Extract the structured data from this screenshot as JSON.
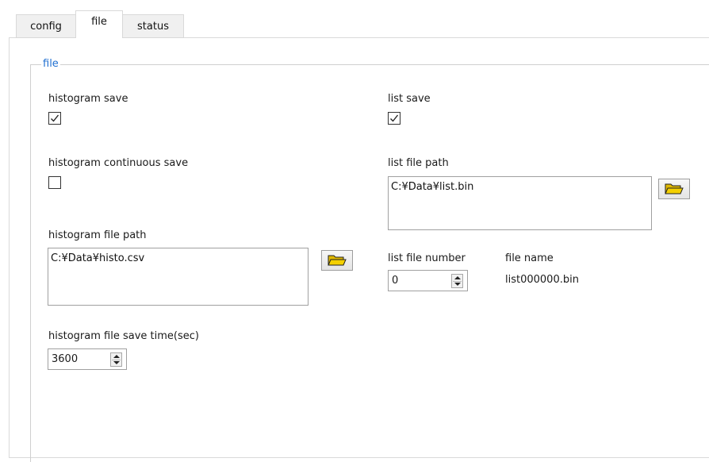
{
  "tabs": [
    {
      "label": "config"
    },
    {
      "label": "file",
      "active": true
    },
    {
      "label": "status"
    }
  ],
  "group": {
    "title": "file"
  },
  "histogram": {
    "save_label": "histogram save",
    "save_checked": true,
    "continuous_label": "histogram continuous save",
    "continuous_checked": false,
    "path_label": "histogram file path",
    "path_value": "C:¥Data¥histo.csv",
    "save_time_label": "histogram file save time(sec)",
    "save_time_value": "3600"
  },
  "list": {
    "save_label": "list save",
    "save_checked": true,
    "path_label": "list file path",
    "path_value": "C:¥Data¥list.bin",
    "number_label": "list file number",
    "number_value": "0",
    "file_name_label": "file name",
    "file_name_value": "list000000.bin"
  },
  "icons": {
    "browse": "folder-open-icon",
    "check": "checkmark-icon",
    "spin": "spin-arrows-icon"
  },
  "colors": {
    "group_title": "#1f6fd1",
    "folder_fill": "#f4d000"
  }
}
